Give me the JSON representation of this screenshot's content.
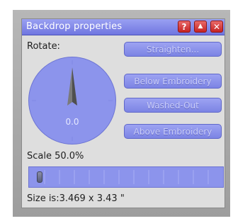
{
  "window": {
    "title": "Backdrop properties",
    "buttons": {
      "help": "?",
      "minimize": "▲",
      "close": "✕"
    }
  },
  "rotate": {
    "label": "Rotate:",
    "value": "0.0",
    "angle_degrees": 0
  },
  "buttons": {
    "straighten": "Straighten...",
    "below_embroidery": "Below Embroidery",
    "washed_out": "Washed-Out",
    "above_embroidery": "Above Embroidery"
  },
  "scale": {
    "label": "Scale 50.0%",
    "slider_position_fraction": 0.02
  },
  "size": {
    "text": "Size is:3.469 x 3.43 \""
  },
  "colors": {
    "accent": "#7c84e4",
    "close_button": "#c62323"
  }
}
